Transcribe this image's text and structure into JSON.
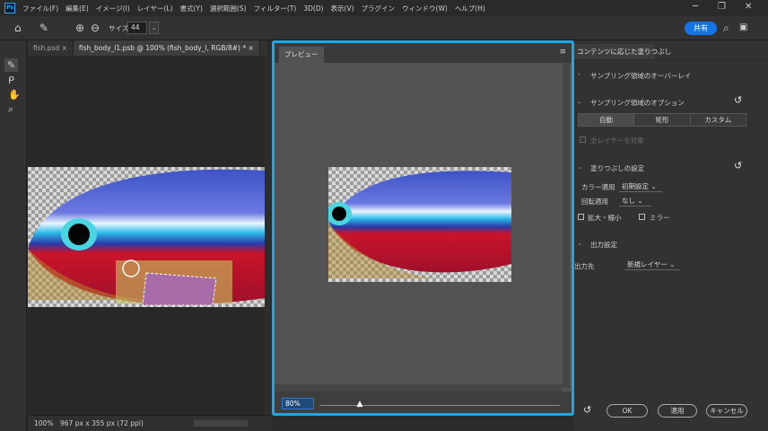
{
  "app": {
    "logo": "Ps"
  },
  "menu": [
    "ファイル(F)",
    "編集(E)",
    "イメージ(I)",
    "レイヤー(L)",
    "書式(Y)",
    "選択範囲(S)",
    "フィルター(T)",
    "3D(D)",
    "表示(V)",
    "プラグイン",
    "ウィンドウ(W)",
    "ヘルプ(H)"
  ],
  "window_controls": {
    "minimize": "─",
    "restore": "❐",
    "close": "✕"
  },
  "options_bar": {
    "size_label": "サイズ",
    "size_value": "44",
    "share_label": "共有"
  },
  "doc_tabs": [
    {
      "label": "fish.psd",
      "close": "×"
    },
    {
      "label": "fish_body_l1.psb @ 100% (fish_body_l, RGB/8#) *",
      "close": "×"
    }
  ],
  "status_bar": {
    "zoom": "100%",
    "doc_info": "967 px x 355 px (72 ppi)"
  },
  "preview": {
    "tab_label": "プレビュー",
    "zoom_value": "80%",
    "zoom_level": 0.17
  },
  "right_panel": {
    "tab_label": "コンテンツに応じた塗りつぶし",
    "sampling_overlay": "サンプリング領域のオーバーレイ",
    "sampling_options": "サンプリング領域のオプション",
    "segments": [
      "自動",
      "矩形",
      "カスタム"
    ],
    "all_layers": "全レイヤーを対象",
    "fill_settings": "塗りつぶしの設定",
    "color_adapt_label": "カラー適用",
    "color_adapt_value": "初期設定",
    "rotation_label": "回転適用",
    "rotation_value": "なし",
    "scale_label": "拡大・縮小",
    "mirror_label": "ミラー",
    "output_settings": "出力設定",
    "output_to_label": "出力先",
    "output_to_value": "新規レイヤー",
    "ok_label": "OK",
    "apply_label": "適用",
    "cancel_label": "キャンセル"
  },
  "colors": {
    "accent": "#1ea7e7",
    "share": "#1473e6",
    "panel": "#323232"
  }
}
